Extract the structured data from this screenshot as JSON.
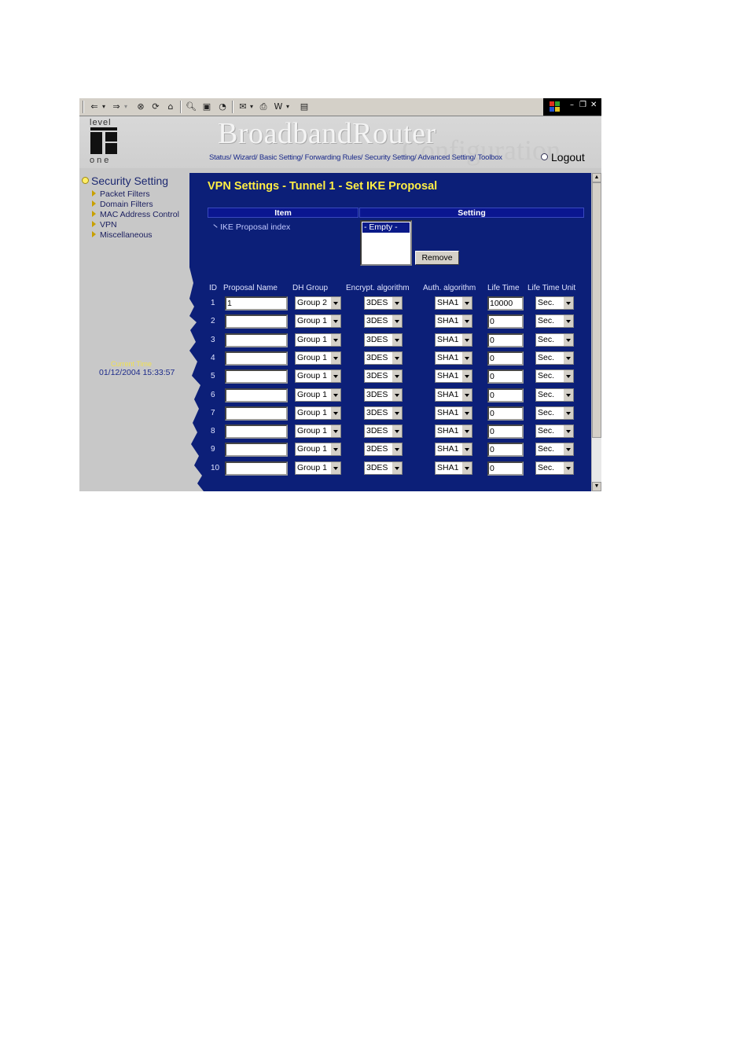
{
  "toolbar": {
    "back_icon": "back-arrow-icon",
    "forward_icon": "forward-arrow-icon",
    "stop_icon": "stop-icon",
    "refresh_icon": "refresh-icon",
    "home_icon": "home-icon",
    "search_icon": "search-icon",
    "favorites_icon": "favorites-icon",
    "history_icon": "history-icon",
    "mail_icon": "mail-icon",
    "print_icon": "print-icon",
    "edit_icon": "edit-icon",
    "discuss_icon": "discuss-icon"
  },
  "header": {
    "brand": "BroadbandRouter",
    "brand_sub": "Configuration",
    "logo_top": "level",
    "logo_bottom": "one",
    "nav": [
      "Status/",
      "Wizard/",
      "Basic Setting/",
      "Forwarding Rules/",
      "Security Setting/",
      "Advanced Setting/",
      "Toolbox"
    ],
    "logout": "Logout"
  },
  "sidebar": {
    "title": "Security Setting",
    "items": [
      "Packet Filters",
      "Domain Filters",
      "MAC Address Control",
      "VPN",
      "Miscellaneous"
    ],
    "current_time_label": "Current Time",
    "current_time": "01/12/2004 15:33:57"
  },
  "main": {
    "title": "VPN Settings - Tunnel 1 - Set IKE Proposal",
    "item_header": "Item",
    "setting_header": "Setting",
    "ike_label": "IKE Proposal index",
    "ike_list_option": "- Empty -",
    "remove_label": "Remove",
    "columns": [
      "ID",
      "Proposal Name",
      "DH Group",
      "Encrypt. algorithm",
      "Auth. algorithm",
      "Life Time",
      "Life Time Unit"
    ],
    "rows": [
      {
        "id": "1",
        "name": "1",
        "dh": "Group 2",
        "enc": "3DES",
        "auth": "SHA1",
        "life": "10000",
        "unit": "Sec."
      },
      {
        "id": "2",
        "name": "",
        "dh": "Group 1",
        "enc": "3DES",
        "auth": "SHA1",
        "life": "0",
        "unit": "Sec."
      },
      {
        "id": "3",
        "name": "",
        "dh": "Group 1",
        "enc": "3DES",
        "auth": "SHA1",
        "life": "0",
        "unit": "Sec."
      },
      {
        "id": "4",
        "name": "",
        "dh": "Group 1",
        "enc": "3DES",
        "auth": "SHA1",
        "life": "0",
        "unit": "Sec."
      },
      {
        "id": "5",
        "name": "",
        "dh": "Group 1",
        "enc": "3DES",
        "auth": "SHA1",
        "life": "0",
        "unit": "Sec."
      },
      {
        "id": "6",
        "name": "",
        "dh": "Group 1",
        "enc": "3DES",
        "auth": "SHA1",
        "life": "0",
        "unit": "Sec."
      },
      {
        "id": "7",
        "name": "",
        "dh": "Group 1",
        "enc": "3DES",
        "auth": "SHA1",
        "life": "0",
        "unit": "Sec."
      },
      {
        "id": "8",
        "name": "",
        "dh": "Group 1",
        "enc": "3DES",
        "auth": "SHA1",
        "life": "0",
        "unit": "Sec."
      },
      {
        "id": "9",
        "name": "",
        "dh": "Group 1",
        "enc": "3DES",
        "auth": "SHA1",
        "life": "0",
        "unit": "Sec."
      },
      {
        "id": "10",
        "name": "",
        "dh": "Group 1",
        "enc": "3DES",
        "auth": "SHA1",
        "life": "0",
        "unit": "Sec."
      }
    ]
  },
  "colors": {
    "content_bg": "#0c1f78",
    "title_yellow": "#ffee44",
    "sidebar_bg": "#c8c8c8"
  }
}
